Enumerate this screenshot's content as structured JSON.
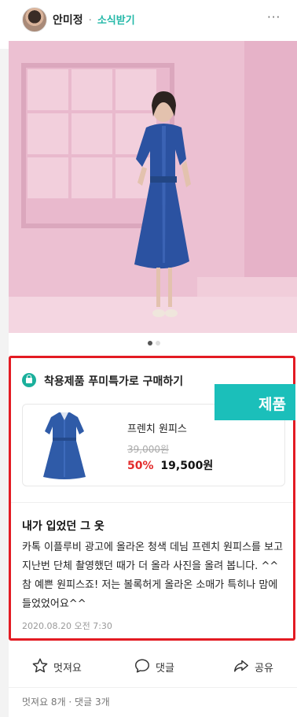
{
  "header": {
    "author": "안미정",
    "separator": "·",
    "subscribe": "소식받기",
    "more": "···",
    "avatar_icon": "profile-avatar"
  },
  "photo": {
    "subject_icon": "woman-blue-dress-pink-room",
    "wall_color": "#ecc0d2"
  },
  "carousel": {
    "total": 2,
    "current": 1,
    "active_color": "#555555",
    "inactive_color": "#dddddd"
  },
  "promo": {
    "icon": "shopping-bag-icon",
    "title": "착용제품 푸미특가로 구매하기",
    "product_name": "프렌치 원피스",
    "original_price": "39,000원",
    "discount": "50%",
    "sale_price": "19,500원",
    "badge": "제품"
  },
  "post": {
    "title": "내가 입었던 그 옷",
    "body": "카톡 이플루비 광고에 올라온 청색 데님 프렌치 원피스를 보고 지난번 단체 촬영했던 때가 더 올라 사진을 올려 봅니다. ^^ 참 예쁜 원피스죠! 저는 볼록허게 올라온 소매가 특히나 맘에 들었었어요^^",
    "date": "2020.08.20 오전 7:30"
  },
  "actions": {
    "like": "멋져요",
    "comment": "댓글",
    "share": "공유"
  },
  "counts": "멋져요 8개 · 댓글 3개",
  "colors": {
    "accent": "#1bb09c",
    "highlight_frame": "#e31b23",
    "discount": "#e32b2b"
  }
}
